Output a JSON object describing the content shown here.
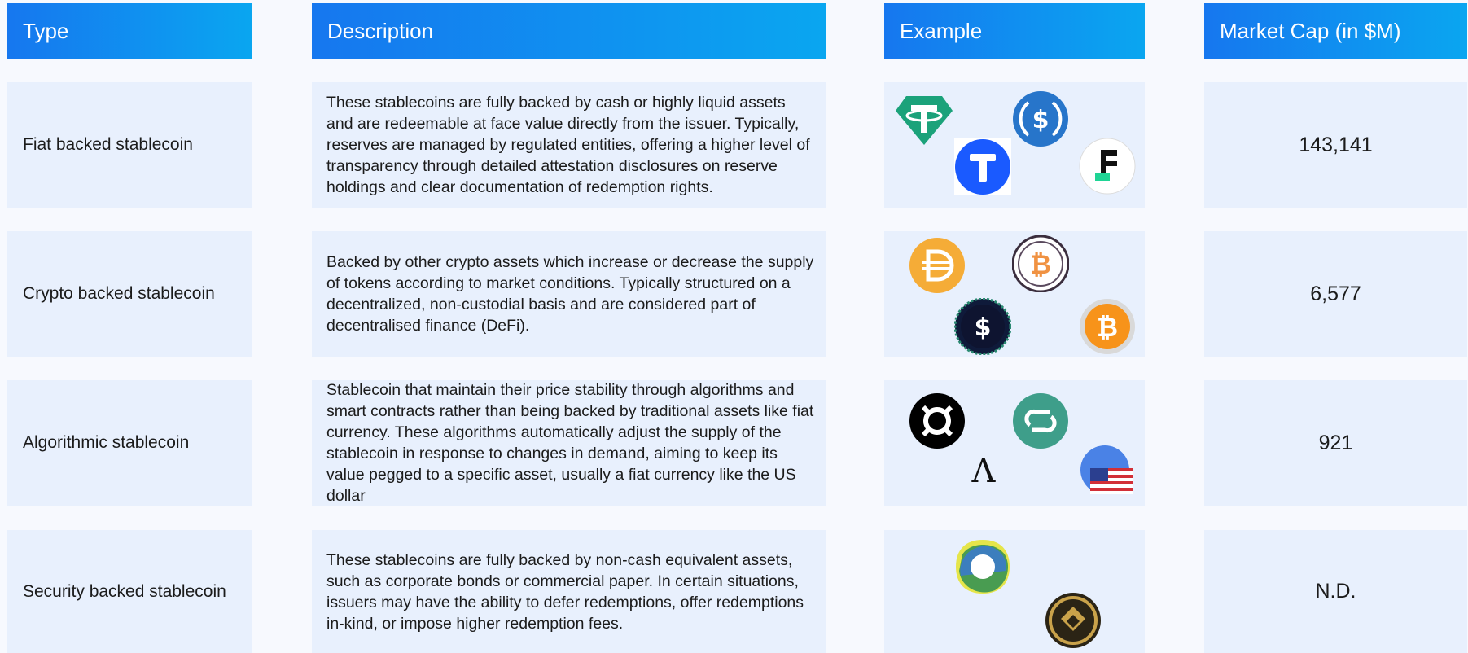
{
  "headers": {
    "type": "Type",
    "description": "Description",
    "example": "Example",
    "market_cap": "Market Cap (in $M)"
  },
  "rows": [
    {
      "type": "Fiat backed stablecoin",
      "description": "These stablecoins are fully backed by cash or highly liquid assets and are redeemable at face value directly from the issuer. Typically, reserves are managed by regulated entities, offering a higher level of transparency through detailed attestation disclosures on reserve holdings and clear documentation of redemption rights.",
      "market_cap": "143,141",
      "logos": [
        "tether-icon",
        "usdc-icon",
        "trueusd-icon",
        "first-digital-usd-icon"
      ]
    },
    {
      "type": "Crypto backed stablecoin",
      "description": "Backed by other crypto assets which increase or decrease the supply of tokens according to market conditions. Typically structured on a decentralized, non-custodial basis and are considered part of decentralised finance (DeFi).",
      "market_cap": "6,577",
      "logos": [
        "dai-icon",
        "wrapped-bitcoin-icon",
        "usds-icon",
        "bitcoin-coin-icon"
      ]
    },
    {
      "type": "Algorithmic stablecoin",
      "description": "Stablecoin that maintain their price stability through algorithms and smart contracts rather than being backed by traditional assets like fiat currency. These algorithms automatically adjust the supply of the stablecoin in response to changes in demand, aiming to keep its value pegged to a specific asset, usually a fiat currency like the US dollar",
      "market_cap": "921",
      "logos": [
        "frax-icon",
        "celo-dollar-icon",
        "lambda-icon",
        "us-flag-coin-icon"
      ]
    },
    {
      "type": "Security backed stablecoin",
      "description": "These stablecoins are fully backed by non-cash equivalent assets, such as corporate bonds or commercial paper. In certain situations, issuers may have the ability to defer redemptions, offer redemptions in-kind, or impose higher redemption fees.",
      "market_cap": "N.D.",
      "logos": [
        "paxos-ring-icon",
        "gold-coin-icon"
      ]
    }
  ],
  "colors": {
    "header_start": "#1677ef",
    "header_end": "#0aa6f0",
    "cell_bg": "#e8f0fd",
    "page_bg": "#f7f9fe"
  }
}
